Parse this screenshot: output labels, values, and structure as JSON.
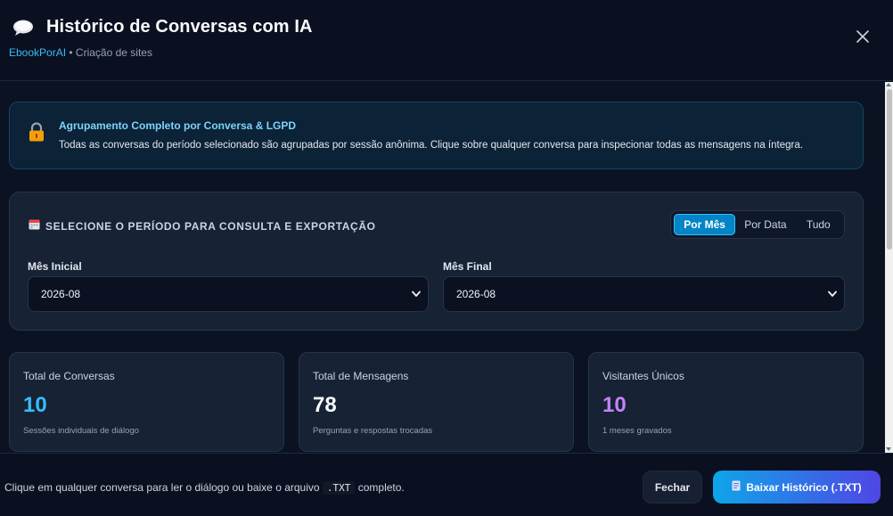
{
  "header": {
    "title": "Histórico de Conversas com IA",
    "subtitle_brand": "EbookPorAI",
    "subtitle_rest": " • Criação de sites"
  },
  "notice": {
    "title": "Agrupamento Completo por Conversa & LGPD",
    "text": "Todas as conversas do período selecionado são agrupadas por sessão anônima. Clique sobre qualquer conversa para inspecionar todas as mensagens na íntegra."
  },
  "period": {
    "title": "SELECIONE O PERÍODO PARA CONSULTA E EXPORTAÇÃO",
    "modes": [
      "Por Mês",
      "Por Data",
      "Tudo"
    ],
    "active_mode": "Por Mês",
    "start_label": "Mês Inicial",
    "start_value": "2026-08",
    "end_label": "Mês Final",
    "end_value": "2026-08"
  },
  "stats": [
    {
      "label": "Total de Conversas",
      "value": "10",
      "desc": "Sessões individuais de diálogo",
      "color": "#38bdf8"
    },
    {
      "label": "Total de Mensagens",
      "value": "78",
      "desc": "Perguntas e respostas trocadas",
      "color": "#f8fafc"
    },
    {
      "label": "Visitantes Únicos",
      "value": "10",
      "desc": "1 meses gravados",
      "color": "#c084fc"
    }
  ],
  "footer": {
    "text_before": "Clique em qualquer conversa para ler o diálogo ou baixe o arquivo ",
    "code": ".TXT",
    "text_after": " completo.",
    "close_label": "Fechar",
    "download_label": "Baixar Histórico (.TXT)"
  },
  "icons": {
    "header": "speech-bubble-icon",
    "close": "close-icon",
    "notice": "lock-icon",
    "period": "calendar-icon",
    "download": "document-icon"
  }
}
